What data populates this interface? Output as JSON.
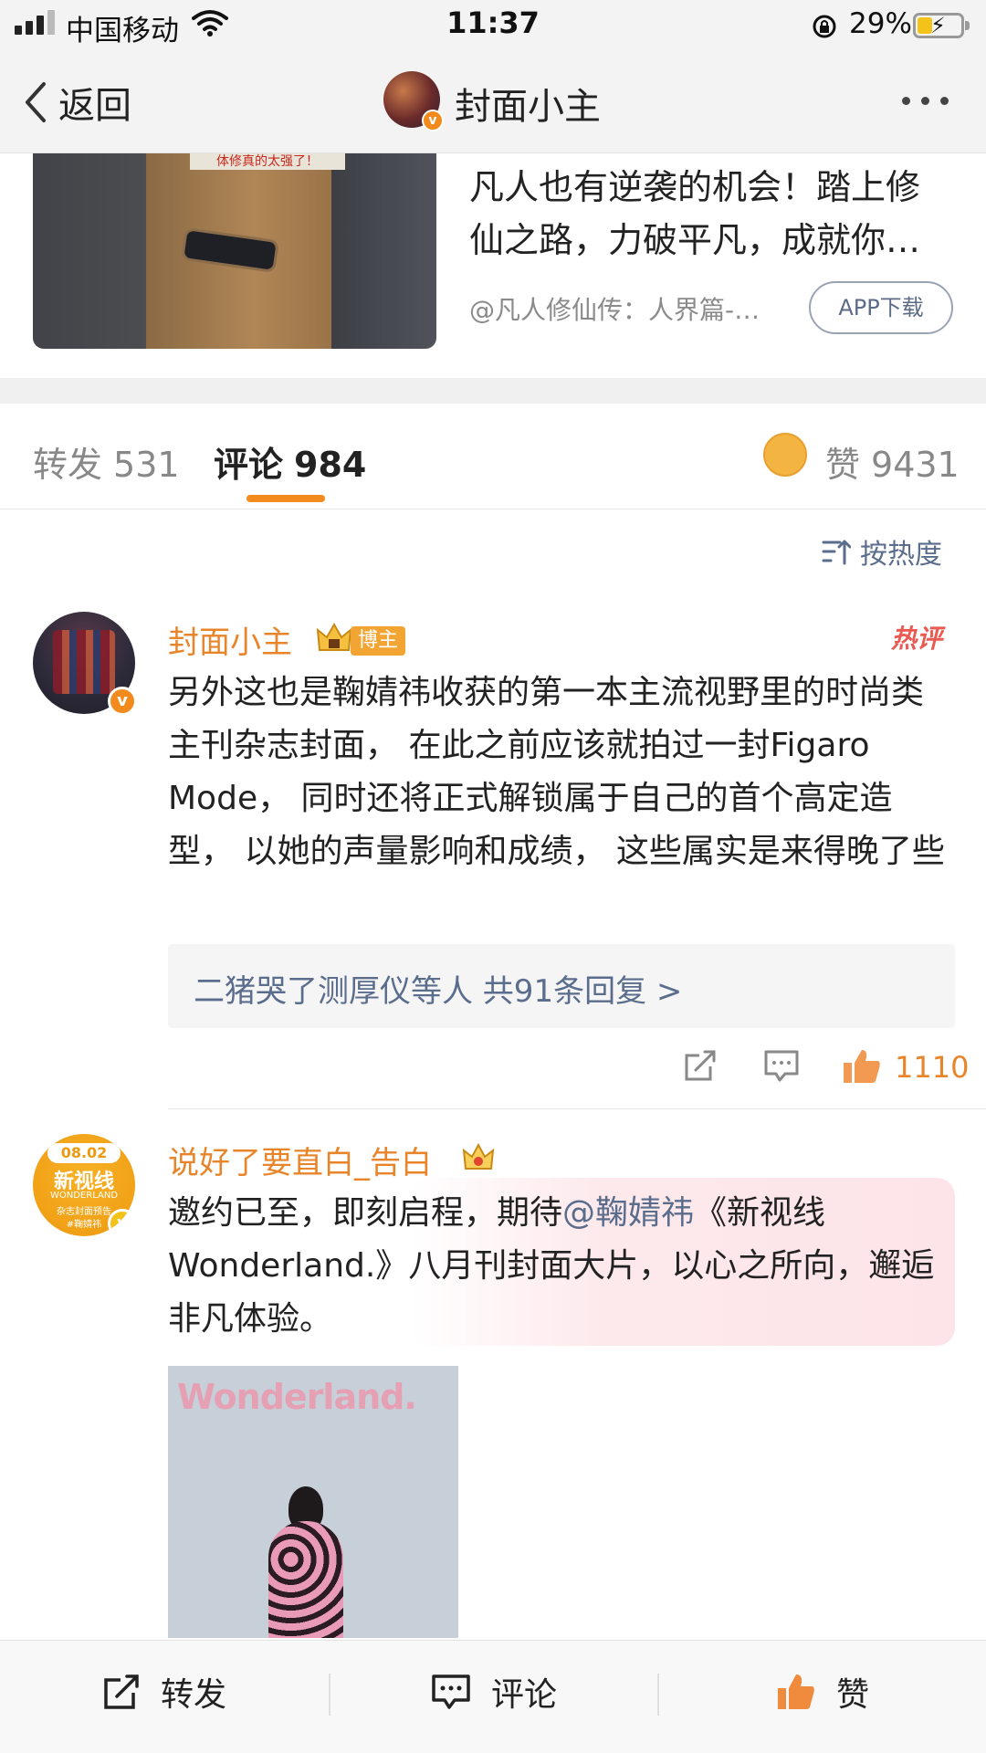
{
  "status_bar": {
    "carrier": "中国移动",
    "time": "11:37",
    "battery_pct": "29%",
    "icons": [
      "signal-icon",
      "wifi-icon",
      "rotation-lock-icon",
      "battery-charging-icon"
    ]
  },
  "nav": {
    "back_label": "返回",
    "title": "封面小主"
  },
  "ad": {
    "thumb_caption": "体修真的太强了！",
    "title": "凡人也有逆袭的机会！踏上修仙之路，力破平凡，成就你…",
    "source": "@凡人修仙传：人界篇-…",
    "button": "APP下载"
  },
  "tabs": {
    "repost_label": "转发",
    "repost_count": "531",
    "comment_label": "评论",
    "comment_count": "984",
    "like_label": "赞",
    "like_count": "9431"
  },
  "sort": {
    "label": "按热度"
  },
  "comments": [
    {
      "name": "封面小主",
      "badge": "博主",
      "hot": "热评",
      "text": "另外这也是鞠婧祎收获的第一本主流视野里的时尚类主刊杂志封面， 在此之前应该就拍过一封Figaro Mode， 同时还将正式解锁属于自己的首个高定造型， 以她的声量影响和成绩， 这些属实是来得晚了些",
      "replies": "二猪哭了测厚仪等人  共91条回复 >",
      "likes": "1110"
    },
    {
      "name": "说好了要直白_告白",
      "avatar_date": "08.02",
      "avatar_line1": "新视线",
      "avatar_line2": "WONDERLAND",
      "avatar_line3": "杂志封面预告",
      "avatar_line4": "#鞠婧祎",
      "text_before": "邀约已至，即刻启程，期待",
      "mention": "@鞠婧祎",
      "text_after": "《新视线Wonderland.》八月刊封面大片，以心之所向，邂逅非凡体验。",
      "image_brand": "Wonderland."
    }
  ],
  "bottom_bar": {
    "repost": "转发",
    "comment": "评论",
    "like": "赞"
  },
  "colors": {
    "accent": "#f28a1d",
    "link": "#5b6d8c",
    "username": "#e8852a",
    "hot": "#ea5a52"
  }
}
